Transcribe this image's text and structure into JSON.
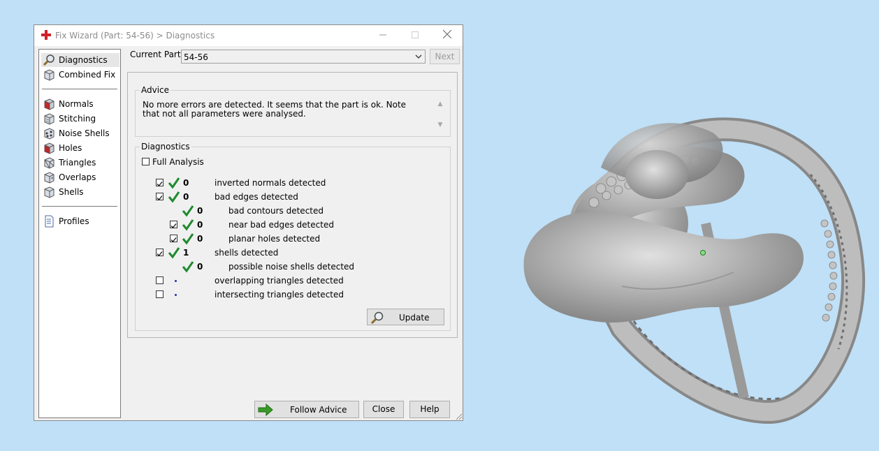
{
  "window": {
    "title": "Fix Wizard (Part: 54-56) > Diagnostics",
    "controls": [
      "minimize",
      "maximize",
      "close"
    ]
  },
  "sidebar": {
    "items": [
      {
        "label": "Diagnostics",
        "icon": "magnifier-icon",
        "selected": true
      },
      {
        "label": "Combined Fix",
        "icon": "cube-icon"
      },
      {
        "label": "Normals",
        "icon": "cube-red-icon"
      },
      {
        "label": "Stitching",
        "icon": "cube-stitch-icon"
      },
      {
        "label": "Noise Shells",
        "icon": "cube-dots-icon"
      },
      {
        "label": "Holes",
        "icon": "cube-hole-icon"
      },
      {
        "label": "Triangles",
        "icon": "cube-triangles-icon"
      },
      {
        "label": "Overlaps",
        "icon": "cube-overlap-icon"
      },
      {
        "label": "Shells",
        "icon": "cube-shells-icon"
      },
      {
        "label": "Profiles",
        "icon": "document-icon"
      }
    ]
  },
  "current_part": {
    "label": "Current Part:",
    "value": "54-56",
    "next_label": "Next"
  },
  "advice": {
    "title": "Advice",
    "text": "No more errors are detected. It seems that the part is ok. Note that not all parameters were analysed."
  },
  "diagnostics": {
    "title": "Diagnostics",
    "full_analysis_label": "Full Analysis",
    "full_analysis_checked": false,
    "rows": [
      {
        "checkbox": true,
        "checked": true,
        "status": "ok",
        "count": "0",
        "label": "inverted normals detected",
        "indent": 0
      },
      {
        "checkbox": true,
        "checked": true,
        "status": "ok",
        "count": "0",
        "label": "bad edges detected",
        "indent": 0
      },
      {
        "checkbox": false,
        "checked": false,
        "status": "ok",
        "count": "0",
        "label": "bad contours detected",
        "indent": 1
      },
      {
        "checkbox": true,
        "checked": true,
        "status": "ok",
        "count": "0",
        "label": "near bad edges detected",
        "indent": 1
      },
      {
        "checkbox": true,
        "checked": true,
        "status": "ok",
        "count": "0",
        "label": "planar holes detected",
        "indent": 1
      },
      {
        "checkbox": true,
        "checked": true,
        "status": "ok",
        "count": "1",
        "label": "shells detected",
        "indent": 0
      },
      {
        "checkbox": false,
        "checked": false,
        "status": "ok",
        "count": "0",
        "label": "possible noise shells detected",
        "indent": 1
      },
      {
        "checkbox": true,
        "checked": false,
        "status": "none",
        "count": "",
        "label": "overlapping triangles detected",
        "indent": 0
      },
      {
        "checkbox": true,
        "checked": false,
        "status": "none",
        "count": "",
        "label": "intersecting triangles detected",
        "indent": 0
      }
    ],
    "update_label": "Update"
  },
  "footer": {
    "follow_advice_label": "Follow Advice",
    "close_label": "Close",
    "help_label": "Help"
  },
  "colors": {
    "desktop": "#bfe0f7",
    "check_green": "#1e8a2e",
    "dot_blue": "#1f2fb0"
  }
}
